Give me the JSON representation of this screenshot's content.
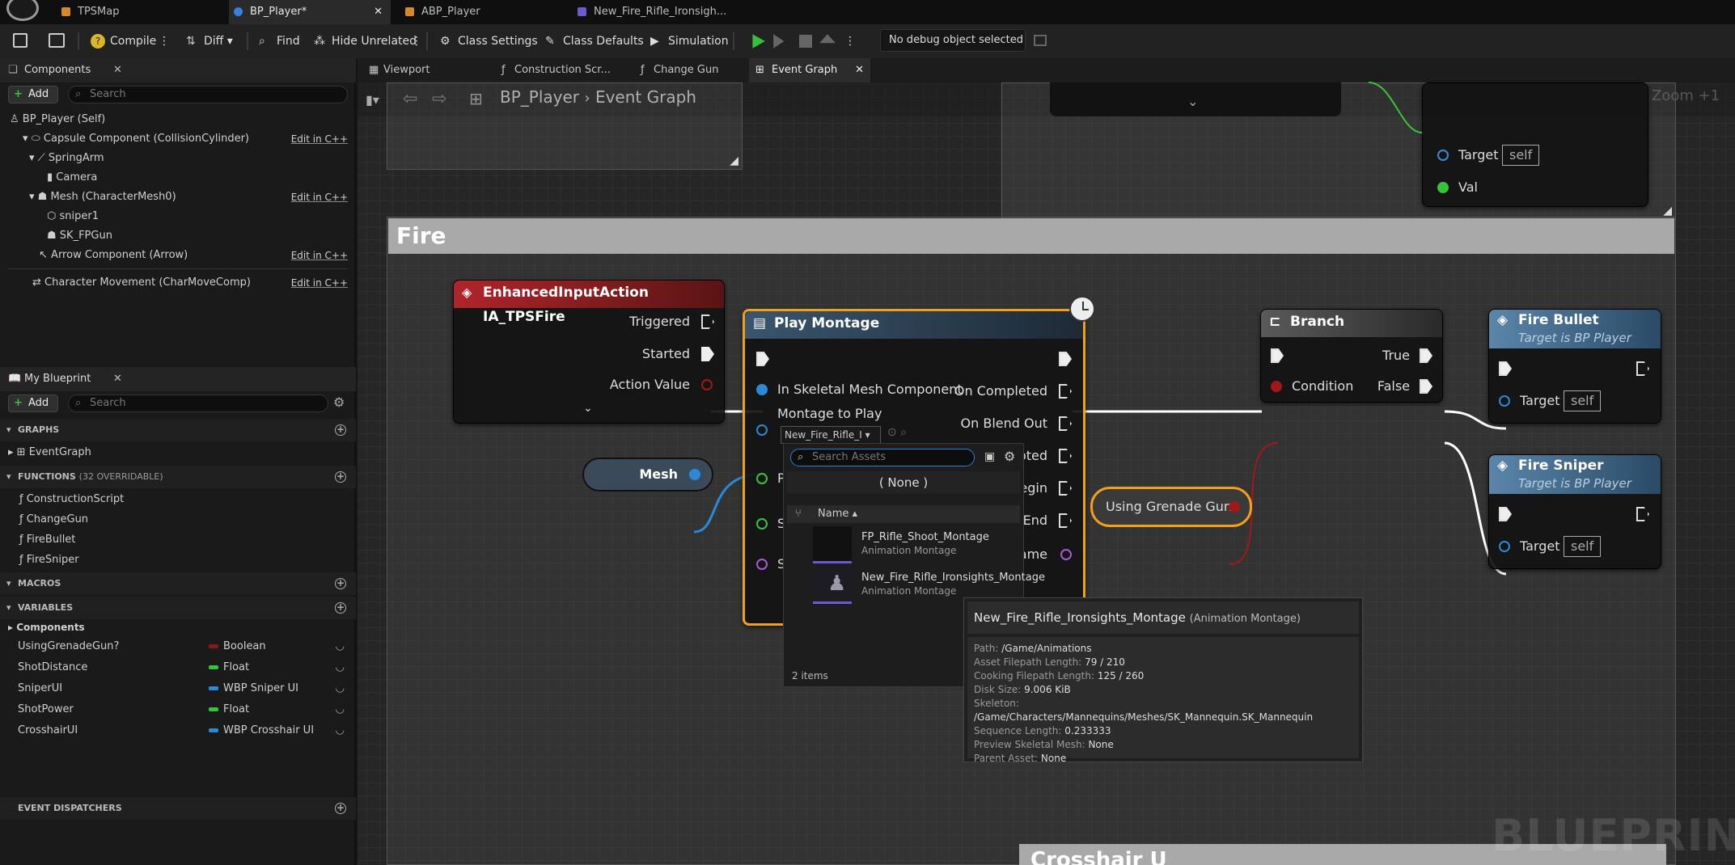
{
  "tabs": [
    "TPSMap",
    "BP_Player*",
    "ABP_Player",
    "New_Fire_Rifle_Ironsigh..."
  ],
  "toolbar": {
    "compile": "Compile",
    "diff": "Diff",
    "find": "Find",
    "hide_unrelated": "Hide Unrelated",
    "class_settings": "Class Settings",
    "class_defaults": "Class Defaults",
    "simulation": "Simulation",
    "debug_object": "No debug object selected"
  },
  "components": {
    "title": "Components",
    "add": "Add",
    "search_placeholder": "Search",
    "root": "BP_Player (Self)",
    "edit_cpp": "Edit in C++",
    "items": [
      "Capsule Component (CollisionCylinder)",
      "SpringArm",
      "Camera",
      "Mesh (CharacterMesh0)",
      "sniper1",
      "SK_FPGun",
      "Arrow Component (Arrow)",
      "Character Movement (CharMoveComp)"
    ]
  },
  "my_blueprint": {
    "title": "My Blueprint",
    "add": "Add",
    "search_placeholder": "Search",
    "graphs_header": "GRAPHS",
    "graphs": [
      "EventGraph"
    ],
    "functions_header": "FUNCTIONS",
    "functions_count": "(32 OVERRIDABLE)",
    "functions": [
      "ConstructionScript",
      "ChangeGun",
      "FireBullet",
      "FireSniper"
    ],
    "macros_header": "MACROS",
    "variables_header": "VARIABLES",
    "components_group": "Components",
    "variables": [
      {
        "name": "UsingGrenadeGun?",
        "type": "Boolean",
        "color": "#8a1a1a"
      },
      {
        "name": "ShotDistance",
        "type": "Float",
        "color": "#38c43a"
      },
      {
        "name": "SniperUI",
        "type": "WBP Sniper UI",
        "color": "#2a8ad8"
      },
      {
        "name": "ShotPower",
        "type": "Float",
        "color": "#38c43a"
      },
      {
        "name": "CrosshairUI",
        "type": "WBP Crosshair UI",
        "color": "#2a8ad8"
      }
    ],
    "dispatchers_header": "EVENT DISPATCHERS"
  },
  "graph_tabs": [
    "Viewport",
    "Construction Scr...",
    "Change Gun",
    "Event Graph"
  ],
  "breadcrumb": {
    "bp": "BP_Player",
    "graph": "Event Graph"
  },
  "zoom": "Zoom +1",
  "comment": "Fire",
  "comment2": "Crosshair U",
  "top_node": {
    "target": "Target",
    "self": "self",
    "val": "Val"
  },
  "nodes": {
    "input": {
      "title": "EnhancedInputAction IA_TPSFire",
      "pins": [
        "Triggered",
        "Started",
        "Action Value"
      ]
    },
    "mesh": "Mesh",
    "play_montage": {
      "title": "Play Montage",
      "pin_mesh": "In Skeletal Mesh Component",
      "pin_montage": "Montage to Play",
      "montage_value": "New_Fire_Rifle_I",
      "out": [
        "On Completed",
        "On Blend Out",
        "On Interrupted",
        "On Notify Begin",
        "On Notify End",
        "Notify Name"
      ],
      "out_visible": [
        "On Completed",
        "On Blend Out",
        "upted",
        "Begin",
        "y End",
        "ame"
      ],
      "left_pins": [
        "P",
        "S",
        "S"
      ]
    },
    "grenade": "Using Grenade Gun?",
    "branch": {
      "title": "Branch",
      "condition": "Condition",
      "true": "True",
      "false": "False"
    },
    "fire_bullet": {
      "title": "Fire Bullet",
      "subtitle": "Target is BP Player",
      "target": "Target",
      "self": "self"
    },
    "fire_sniper": {
      "title": "Fire Sniper",
      "subtitle": "Target is BP Player",
      "target": "Target",
      "self": "self"
    }
  },
  "dropdown": {
    "search_placeholder": "Search Assets",
    "none": "( None )",
    "col": "Name",
    "items": [
      {
        "name": "FP_Rifle_Shoot_Montage",
        "type": "Animation Montage"
      },
      {
        "name": "New_Fire_Rifle_Ironsights_Montage",
        "type": "Animation Montage"
      }
    ],
    "count": "2 items"
  },
  "tooltip": {
    "name": "New_Fire_Rifle_Ironsights_Montage",
    "kind": "(Animation Montage)",
    "rows": [
      {
        "k": "Path:",
        "v": "/Game/Animations"
      },
      {
        "k": "Asset Filepath Length:",
        "v": "79 / 210"
      },
      {
        "k": "Cooking Filepath Length:",
        "v": "125 / 260"
      },
      {
        "k": "Disk Size:",
        "v": "9.006 KiB"
      },
      {
        "k": "Skeleton:",
        "v": "/Game/Characters/Mannequins/Meshes/SK_Mannequin.SK_Mannequin"
      },
      {
        "k": "Sequence Length:",
        "v": "0.233333"
      },
      {
        "k": "Preview Skeletal Mesh:",
        "v": "None"
      },
      {
        "k": "Parent Asset:",
        "v": "None"
      }
    ]
  },
  "watermark": "BLUEPRINT"
}
